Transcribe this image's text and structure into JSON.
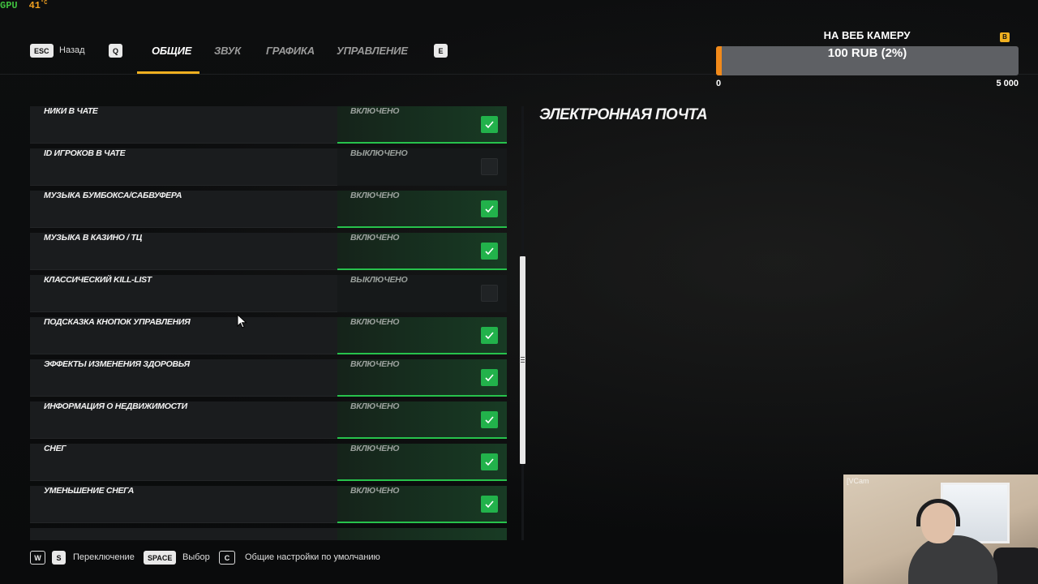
{
  "overlay": {
    "gpu_label": "GPU",
    "gpu_temp": "41",
    "gpu_unit": "°C"
  },
  "nav": {
    "back_key": "ESC",
    "back_label": "Назад",
    "prev_key": "Q",
    "next_key": "E",
    "tabs": [
      {
        "label": "Общие",
        "active": true
      },
      {
        "label": "Звук",
        "active": false
      },
      {
        "label": "Графика",
        "active": false
      },
      {
        "label": "Управление",
        "active": false
      }
    ]
  },
  "settings": [
    {
      "label": "Ники в чате",
      "state": "Включено",
      "on": true
    },
    {
      "label": "ID игроков в чате",
      "state": "Выключено",
      "on": false
    },
    {
      "label": "Музыка бумбокса/сабвуфера",
      "state": "Включено",
      "on": true
    },
    {
      "label": "Музыка в казино / ТЦ",
      "state": "Включено",
      "on": true
    },
    {
      "label": "Классический Kill-list",
      "state": "Выключено",
      "on": false
    },
    {
      "label": "Подсказка кнопок управления",
      "state": "Включено",
      "on": true
    },
    {
      "label": "Эффекты изменения здоровья",
      "state": "Включено",
      "on": true
    },
    {
      "label": "Информация о недвижимости",
      "state": "Включено",
      "on": true
    },
    {
      "label": "Снег",
      "state": "Включено",
      "on": true
    },
    {
      "label": "Уменьшение снега",
      "state": "Включено",
      "on": true
    }
  ],
  "info": {
    "title": "Электронная почта"
  },
  "donation": {
    "title": "НА ВЕБ КАМЕРУ",
    "progress_text": "100 RUB (2%)",
    "progress_fraction": 0.02,
    "min": "0",
    "max": "5 000",
    "badge": "B",
    "fill_color": "#f28a1a"
  },
  "webcam": {
    "label": "[VCam"
  },
  "hints": {
    "up_key": "W",
    "down_key": "S",
    "switch_label": "Переключение",
    "select_key": "SPACE",
    "select_label": "Выбор",
    "reset_key": "C",
    "reset_label": "Общие настройки по умолчанию"
  },
  "colors": {
    "accent": "#f0b020",
    "on_green": "#22b24b"
  },
  "icons": {
    "checkbox_on": "check-icon",
    "cursor": "cursor-arrow-icon"
  }
}
